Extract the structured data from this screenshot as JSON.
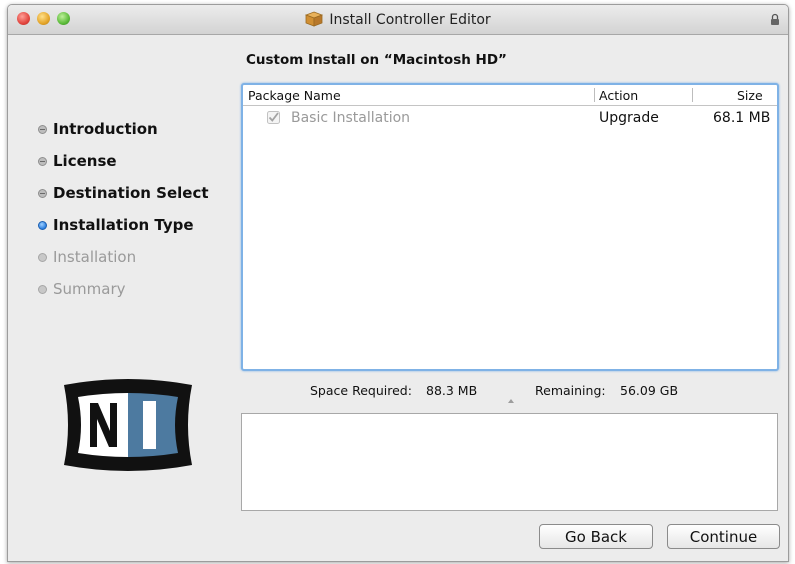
{
  "window": {
    "title": "Install Controller Editor"
  },
  "heading": "Custom Install on “Macintosh HD”",
  "steps": [
    {
      "label": "Introduction",
      "state": "done"
    },
    {
      "label": "License",
      "state": "done"
    },
    {
      "label": "Destination Select",
      "state": "done"
    },
    {
      "label": "Installation Type",
      "state": "current"
    },
    {
      "label": "Installation",
      "state": "future"
    },
    {
      "label": "Summary",
      "state": "future"
    }
  ],
  "table": {
    "columns": [
      "Package Name",
      "Action",
      "Size"
    ],
    "rows": [
      {
        "name": "Basic Installation",
        "action": "Upgrade",
        "size": "68.1 MB",
        "checked": true
      }
    ]
  },
  "space": {
    "required_label": "Space Required:",
    "required_value": "88.3 MB",
    "remaining_label": "Remaining:",
    "remaining_value": "56.09 GB"
  },
  "buttons": {
    "back": "Go Back",
    "continue": "Continue"
  },
  "colors": {
    "accent": "#2a7ee0",
    "table_focus": "#7fb2e6",
    "logo_blue": "#4d7aa0"
  },
  "icons": [
    "package-icon",
    "lock-icon",
    "checkbox-icon",
    "ni-logo"
  ]
}
